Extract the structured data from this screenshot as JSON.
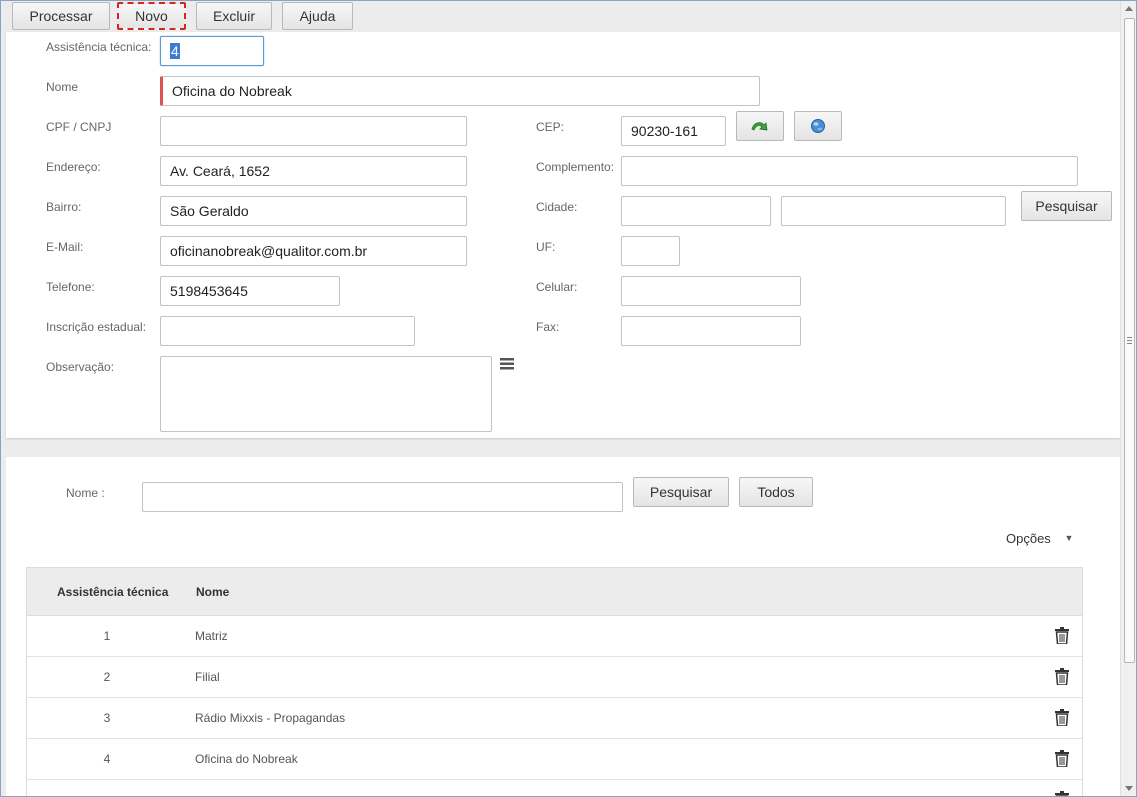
{
  "toolbar": {
    "processar": "Processar",
    "novo": "Novo",
    "excluir": "Excluir",
    "ajuda": "Ajuda"
  },
  "form": {
    "assistencia_label": "Assistência técnica:",
    "assistencia_value": "4",
    "nome_label": "Nome",
    "nome_value": "Oficina do Nobreak",
    "cpf_label": "CPF / CNPJ",
    "cpf_value": "",
    "cep_label": "CEP:",
    "cep_value": "90230-161",
    "endereco_label": "Endereço:",
    "endereco_value": "Av. Ceará, 1652",
    "complemento_label": "Complemento:",
    "complemento_value": "",
    "bairro_label": "Bairro:",
    "bairro_value": "São Geraldo",
    "cidade_label": "Cidade:",
    "cidade_value": "",
    "cidade_name_value": "",
    "pesquisar": "Pesquisar",
    "email_label": "E-Mail:",
    "email_value": "oficinanobreak@qualitor.com.br",
    "uf_label": "UF:",
    "uf_value": "",
    "telefone_label": "Telefone:",
    "telefone_value": "5198453645",
    "celular_label": "Celular:",
    "celular_value": "",
    "inscricao_label": "Inscrição estadual:",
    "inscricao_value": "",
    "fax_label": "Fax:",
    "fax_value": "",
    "observacao_label": "Observação:",
    "observacao_value": ""
  },
  "search": {
    "nome_label": "Nome :",
    "nome_value": "",
    "pesquisar": "Pesquisar",
    "todos": "Todos",
    "opcoes": "Opções"
  },
  "grid": {
    "columns": [
      "Assistência técnica",
      "Nome"
    ],
    "rows": [
      {
        "id": "1",
        "nome": "Matriz"
      },
      {
        "id": "2",
        "nome": "Filial"
      },
      {
        "id": "3",
        "nome": "Rádio Mixxis - Propagandas"
      },
      {
        "id": "4",
        "nome": "Oficina do Nobreak"
      }
    ]
  },
  "icons": {
    "cep_search": "green-arrow-icon",
    "cep_globe": "globe-icon",
    "observacao_menu": "menu-icon",
    "row_delete": "trash-icon",
    "opcoes_dropdown": "caret-down-icon"
  }
}
